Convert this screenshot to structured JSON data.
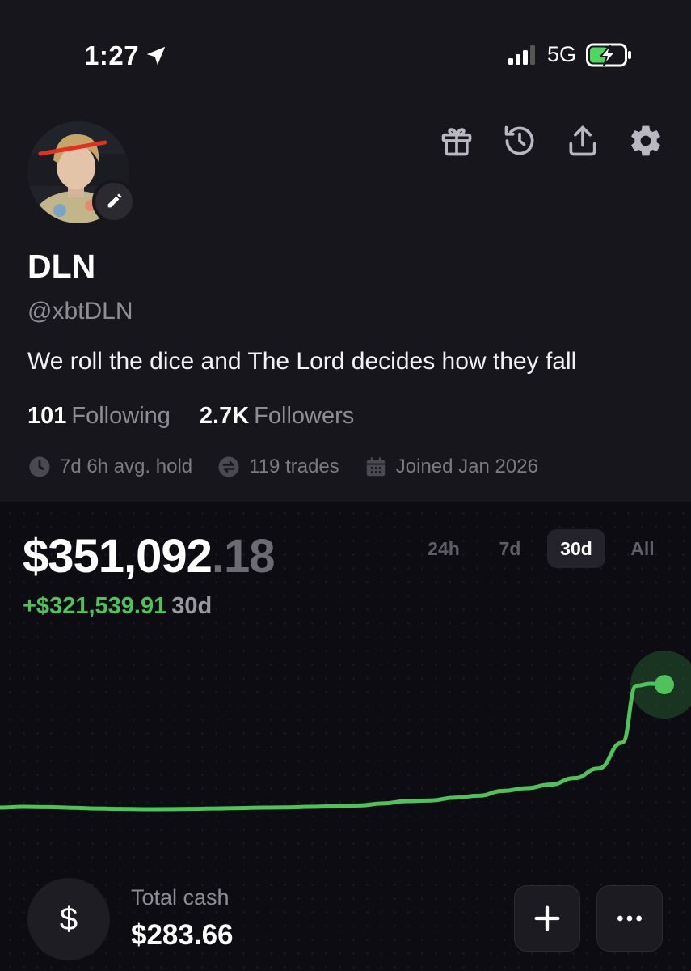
{
  "status_bar": {
    "time": "1:27",
    "network": "5G",
    "location_icon": "location-arrow-icon",
    "signal_icon": "signal-bars-icon",
    "battery_icon": "battery-charging-icon"
  },
  "profile": {
    "display_name": "DLN",
    "handle": "@xbtDLN",
    "bio": "We roll the dice and The Lord decides how they fall",
    "following_count": "101",
    "following_label": "Following",
    "followers_count": "2.7K",
    "followers_label": "Followers",
    "avg_hold": "7d 6h avg. hold",
    "trades": "119 trades",
    "joined": "Joined Jan 2026"
  },
  "header_actions": [
    "gift-icon",
    "history-icon",
    "share-icon",
    "settings-icon"
  ],
  "portfolio": {
    "balance_main": "$351,092",
    "balance_cents": ".18",
    "change_amount": "+$321,539.91",
    "change_period": "30d",
    "ranges": [
      "24h",
      "7d",
      "30d",
      "All"
    ],
    "active_range": "30d"
  },
  "chart_data": {
    "type": "line",
    "x": [
      0,
      1,
      2,
      3,
      4,
      5,
      6,
      7,
      8,
      9,
      10,
      11,
      12,
      13,
      14,
      15,
      16,
      17,
      18,
      19,
      20,
      21,
      22,
      23,
      24,
      25,
      26,
      27,
      28,
      29,
      30
    ],
    "series": [
      {
        "values": [
          29550,
          29600,
          29580,
          29540,
          29500,
          29480,
          29460,
          29470,
          29480,
          29500,
          29520,
          29550,
          29560,
          29600,
          29650,
          29700,
          29900,
          30200,
          30300,
          30800,
          31200,
          32500,
          33500,
          35000,
          38500,
          46000,
          85000,
          342000,
          358000,
          351092
        ]
      }
    ],
    "line_color": "#4fc35a"
  },
  "cash": {
    "label": "Total cash",
    "value": "$283.66",
    "symbol": "$"
  },
  "actions": {
    "add_icon": "plus-icon",
    "more_icon": "more-horizontal-icon"
  }
}
